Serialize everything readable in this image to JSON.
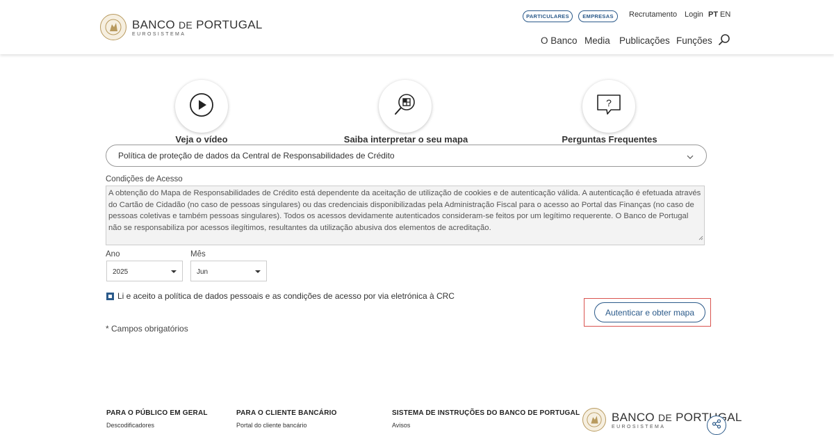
{
  "header": {
    "logo": {
      "main_a": "BANCO ",
      "main_b": "DE",
      "main_c": " PORTUGAL",
      "sub": "EUROSISTEMA"
    },
    "pills": [
      "PARTICULARES",
      "EMPRESAS"
    ],
    "top_links": {
      "recruitment": "Recrutamento",
      "login": "Login",
      "lang_pt": "PT",
      "lang_en": "EN"
    },
    "nav": [
      "O Banco",
      "Media",
      "Publicações",
      "Funções"
    ]
  },
  "features": [
    {
      "label": "Veja o vídeo",
      "icon": "play-icon"
    },
    {
      "label": "Saiba interpretar o seu mapa",
      "icon": "magnifier-icon"
    },
    {
      "label": "Perguntas Frequentes",
      "icon": "question-bubble-icon"
    }
  ],
  "policy_select": {
    "value": "Política de proteção de dados da Central de Responsabilidades de Crédito"
  },
  "conditions": {
    "label": "Condições de Acesso",
    "text": "A obtenção do Mapa de Responsabilidades de Crédito está dependente da aceitação de utilização de cookies e de autenticação válida. A autenticação é efetuada através do Cartão de Cidadão (no caso de pessoas singulares) ou das credenciais disponibilizadas pela Administração Fiscal para o acesso ao Portal das Finanças (no caso de pessoas coletivas e também pessoas singulares). Todos os acessos devidamente autenticados consideram-se feitos por um legítimo requerente. O Banco de Portugal não se responsabiliza por acessos ilegítimos, resultantes da utilização abusiva dos elementos de acreditação."
  },
  "year": {
    "label": "Ano",
    "value": "2025"
  },
  "month": {
    "label": "Mês",
    "value": "Jun"
  },
  "consent": {
    "checked": true,
    "label": "Li e aceito a política de dados pessoais e as condições de acesso por via eletrónica à CRC"
  },
  "required_note": "* Campos obrigatórios",
  "submit_label": "Autenticar e obter mapa",
  "footer": {
    "columns": [
      {
        "heading": "PARA O PÚBLICO EM GERAL",
        "link": "Descodificadores"
      },
      {
        "heading": "PARA O CLIENTE BANCÁRIO",
        "link": "Portal do cliente bancário"
      },
      {
        "heading": "SISTEMA DE INSTRUÇÕES DO BANCO DE PORTUGAL",
        "link": "Avisos"
      }
    ]
  },
  "colors": {
    "accent": "#2b5a8a",
    "highlight": "#d9534f",
    "gold": "#b89a5e"
  }
}
